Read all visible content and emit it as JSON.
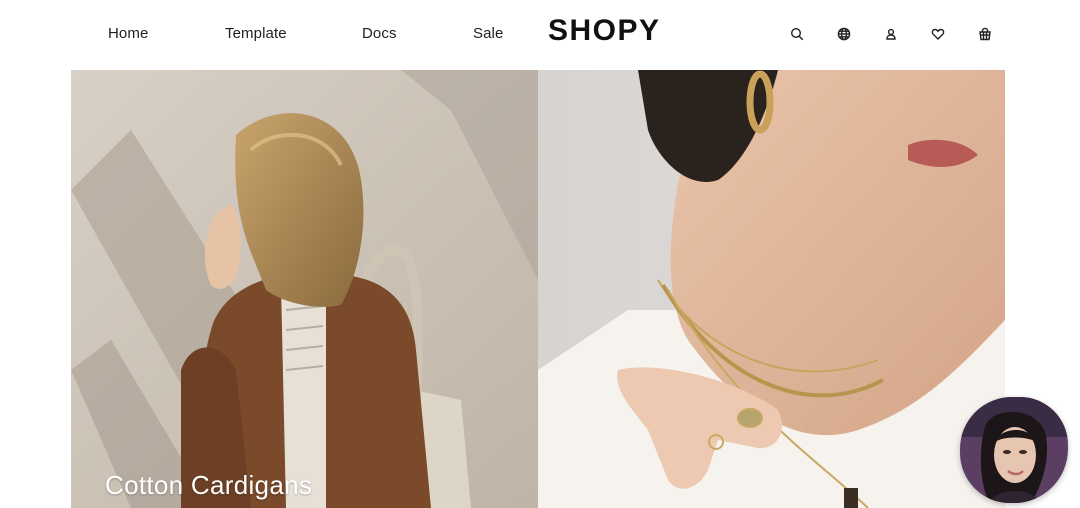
{
  "header": {
    "nav": [
      {
        "label": "Home"
      },
      {
        "label": "Template"
      },
      {
        "label": "Docs"
      },
      {
        "label": "Sale"
      }
    ],
    "logo": "SHOPY",
    "icons": [
      "search-icon",
      "globe-icon",
      "user-icon",
      "heart-icon",
      "cart-icon"
    ]
  },
  "hero": {
    "panels": [
      {
        "caption": "Cotton Cardigans",
        "image": "woman-brown-cardigan-tote-bag"
      },
      {
        "caption": "",
        "image": "woman-gold-necklaces-ring"
      }
    ]
  },
  "chat_widget": {
    "image": "woman-face-avatar"
  },
  "colors": {
    "background": "#ffffff",
    "text": "#1f1f1f",
    "caption": "#ffffff",
    "panel_left_bg": "#cdc3b6",
    "panel_right_bg": "#d9d6d3"
  }
}
